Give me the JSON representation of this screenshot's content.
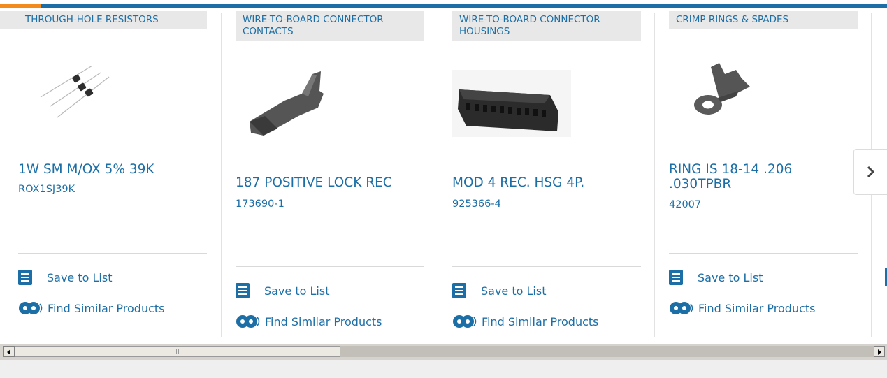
{
  "products": [
    {
      "category": "THROUGH-HOLE RESISTORS",
      "name": "1W SM M/OX 5% 39K",
      "part_number": "ROX1SJ39K",
      "save_label": "Save to List",
      "similar_label": "Find Similar Products",
      "image_icon": "resistor-image"
    },
    {
      "category": "WIRE-TO-BOARD CONNECTOR CONTACTS",
      "name": "187 POSITIVE LOCK REC",
      "part_number": "173690-1",
      "save_label": "Save to List",
      "similar_label": "Find Similar Products",
      "image_icon": "crimp-contact-image"
    },
    {
      "category": "WIRE-TO-BOARD CONNECTOR HOUSINGS",
      "name": "MOD 4 REC. HSG 4P.",
      "part_number": "925366-4",
      "save_label": "Save to List",
      "similar_label": "Find Similar Products",
      "image_icon": "connector-housing-image"
    },
    {
      "category": "CRIMP RINGS & SPADES",
      "name": "RING IS 18-14 .206 .030TPBR",
      "part_number": "42007",
      "save_label": "Save to List",
      "similar_label": "Find Similar Products",
      "image_icon": "ring-terminal-image"
    }
  ],
  "colors": {
    "accent": "#1c6fa6",
    "highlight": "#f28a1c",
    "category_bg": "#e8e8e8"
  },
  "icons": {
    "save": "checklist-icon",
    "similar": "gears-icon",
    "next": "chevron-right-icon"
  }
}
